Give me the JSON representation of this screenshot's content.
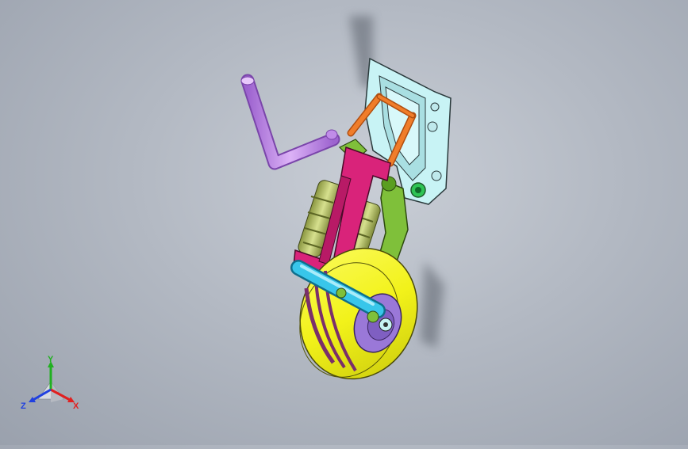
{
  "viewport": {
    "background_top": "#c9ced6",
    "background_bottom": "#9aa1ad"
  },
  "model": {
    "name_icon": "landing-gear-assembly",
    "colors": {
      "handle": "#c08ce8",
      "bracket": "#c8f3f5",
      "link_orange": "#f07d2a",
      "frame_magenta": "#d9237a",
      "swing_arm_green": "#7fc03a",
      "spring_olive": "#b6c26a",
      "axle_cyan": "#38c6ea",
      "tire_yellow": "#f2f21a",
      "hub_purple": "#9a78d8",
      "bushing_green": "#2ec455"
    }
  },
  "triad": {
    "x_label": "X",
    "y_label": "Y",
    "z_label": "Z",
    "x_color": "#e02020",
    "y_color": "#20b020",
    "z_color": "#2040e0"
  }
}
